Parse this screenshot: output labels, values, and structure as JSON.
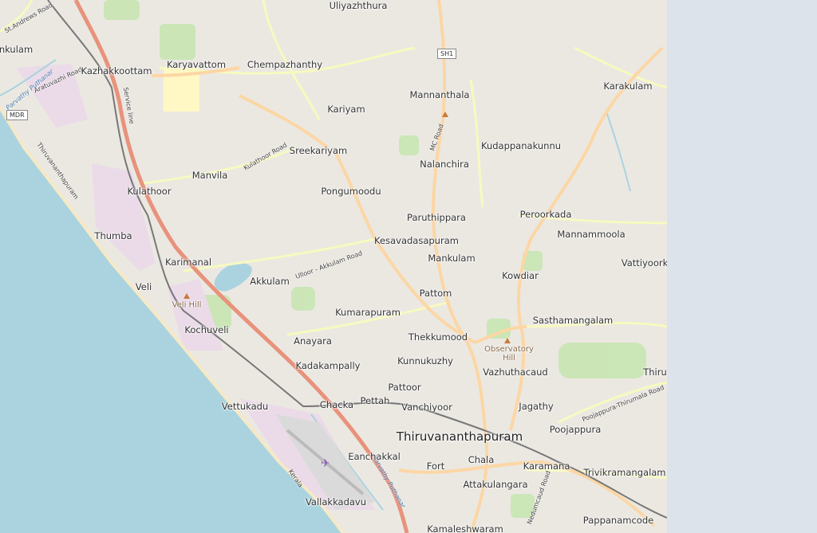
{
  "map": {
    "colors": {
      "sea": "#aad3df",
      "land": "#f2efe9",
      "built": "#e7e4de",
      "motorway": "#e8927c",
      "primary": "#fcd6a4",
      "secondary": "#f7fabf",
      "rail": "#777777",
      "green": "#c8e5b3",
      "industrial": "#ebdbe8",
      "lake": "#aad3df",
      "background": "#dde3ea"
    },
    "places": [
      {
        "id": "uliyazhthura",
        "name": "Uliyazhthura"
      },
      {
        "id": "kazhakkoottam",
        "name": "Kazhakkoottam"
      },
      {
        "id": "karyavattom",
        "name": "Karyavattom"
      },
      {
        "id": "chempazhanthy",
        "name": "Chempazhanthy"
      },
      {
        "id": "mannanthala",
        "name": "Mannanthala"
      },
      {
        "id": "karakulam",
        "name": "Karakulam"
      },
      {
        "id": "kariyam",
        "name": "Kariyam"
      },
      {
        "id": "sreekariyam",
        "name": "Sreekariyam"
      },
      {
        "id": "kudappanakunnu",
        "name": "Kudappanakunnu"
      },
      {
        "id": "nalanchira",
        "name": "Nalanchira"
      },
      {
        "id": "manvila",
        "name": "Manvila"
      },
      {
        "id": "kulathoor",
        "name": "Kulathoor"
      },
      {
        "id": "pongumoodu",
        "name": "Pongumoodu"
      },
      {
        "id": "paruthippara",
        "name": "Paruthippara"
      },
      {
        "id": "peroorkada",
        "name": "Peroorkada"
      },
      {
        "id": "thumba",
        "name": "Thumba"
      },
      {
        "id": "mannammoola",
        "name": "Mannammoola"
      },
      {
        "id": "kesavadasapuram",
        "name": "Kesavadasapuram"
      },
      {
        "id": "karimanal",
        "name": "Karimanal"
      },
      {
        "id": "mankulam",
        "name": "Mankulam"
      },
      {
        "id": "vattiyoork",
        "name": "Vattiyoork"
      },
      {
        "id": "akkulam",
        "name": "Akkulam"
      },
      {
        "id": "kowdiar",
        "name": "Kowdiar"
      },
      {
        "id": "veli",
        "name": "Veli"
      },
      {
        "id": "pattom",
        "name": "Pattom"
      },
      {
        "id": "kumarapuram",
        "name": "Kumarapuram"
      },
      {
        "id": "sasthamangalam",
        "name": "Sasthamangalam"
      },
      {
        "id": "kochuveli",
        "name": "Kochuveli"
      },
      {
        "id": "thekkumood",
        "name": "Thekkumood"
      },
      {
        "id": "anayara",
        "name": "Anayara"
      },
      {
        "id": "kunnukuzhy",
        "name": "Kunnukuzhy"
      },
      {
        "id": "vazhuthacaud",
        "name": "Vazhuthacaud"
      },
      {
        "id": "thiru",
        "name": "Thiru"
      },
      {
        "id": "kadakampally",
        "name": "Kadakampally"
      },
      {
        "id": "pattoor",
        "name": "Pattoor"
      },
      {
        "id": "pettah",
        "name": "Pettah"
      },
      {
        "id": "vettukadu",
        "name": "Vettukadu"
      },
      {
        "id": "chacka",
        "name": "Chacka"
      },
      {
        "id": "vanchiyoor",
        "name": "Vanchiyoor"
      },
      {
        "id": "jagathy",
        "name": "Jagathy"
      },
      {
        "id": "poojappura",
        "name": "Poojappura"
      },
      {
        "id": "thiruvananthapuram",
        "name": "Thiruvananthapuram"
      },
      {
        "id": "eanchakkal",
        "name": "Eanchakkal"
      },
      {
        "id": "chala",
        "name": "Chala"
      },
      {
        "id": "fort",
        "name": "Fort"
      },
      {
        "id": "karamana",
        "name": "Karamana"
      },
      {
        "id": "trivikramangalam",
        "name": "Trivikramangalam"
      },
      {
        "id": "attakulangara",
        "name": "Attakulangara"
      },
      {
        "id": "vallakkadavu",
        "name": "Vallakkadavu"
      },
      {
        "id": "pappanamcode",
        "name": "Pappanamcode"
      },
      {
        "id": "kamaleshwaram",
        "name": "Kamaleshwaram"
      },
      {
        "id": "nkulam",
        "name": "nkulam"
      }
    ],
    "pois": [
      {
        "id": "veli-hill",
        "name": "Veli Hill"
      },
      {
        "id": "observatory-hill",
        "name": "Observatory\nHill"
      }
    ],
    "road_labels": [
      {
        "id": "st-andrews-road",
        "name": "St.Andrews Road"
      },
      {
        "id": "aratuvazhi-road",
        "name": "Aratuvazhi Road"
      },
      {
        "id": "service-line",
        "name": "Service line"
      },
      {
        "id": "kulathoor-road",
        "name": "Kulathoor Road"
      },
      {
        "id": "mc-road",
        "name": "MC Road"
      },
      {
        "id": "ulloor-akkulam-road",
        "name": "Ulloor - Akkulam Road"
      },
      {
        "id": "poojappura-thirumala-road",
        "name": "Poojappura-Thirumala Road"
      },
      {
        "id": "nedumcaud-road",
        "name": "Nedumcaud Road"
      },
      {
        "id": "thiruvananthapuram-rail",
        "name": "Thiruvananthapuram"
      },
      {
        "id": "kerala",
        "name": "Kerala"
      }
    ],
    "water_labels": [
      {
        "id": "parvathy-puthanar-north",
        "name": "Parvathy Puthanar"
      },
      {
        "id": "parvathy-puthanar-south",
        "name": "Parvathy Puthanar"
      }
    ],
    "shields": [
      {
        "id": "sh1",
        "name": "SH1"
      },
      {
        "id": "mdr",
        "name": "MDR"
      }
    ]
  }
}
